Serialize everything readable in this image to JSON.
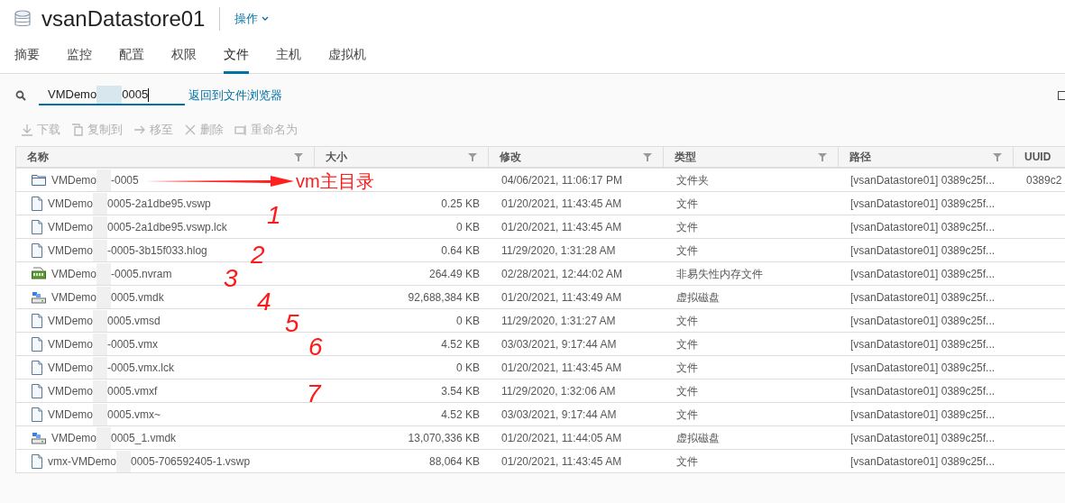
{
  "header": {
    "title": "vsanDatastore01",
    "actions_menu": "操作"
  },
  "tabs": [
    {
      "label": "摘要",
      "selected": false
    },
    {
      "label": "监控",
      "selected": false
    },
    {
      "label": "配置",
      "selected": false
    },
    {
      "label": "权限",
      "selected": false
    },
    {
      "label": "文件",
      "selected": true
    },
    {
      "label": "主机",
      "selected": false
    },
    {
      "label": "虚拟机",
      "selected": false
    }
  ],
  "search": {
    "value_start": "VMDemo",
    "value_end": "0005",
    "back_link": "返回到文件浏览器"
  },
  "toolbar": [
    {
      "kind": "download",
      "label": "下载",
      "disabled": true
    },
    {
      "kind": "copy",
      "label": "复制到",
      "disabled": true
    },
    {
      "kind": "move",
      "label": "移至",
      "disabled": true
    },
    {
      "kind": "delete",
      "label": "删除",
      "disabled": true
    },
    {
      "kind": "rename",
      "label": "重命名为",
      "disabled": true
    }
  ],
  "table": {
    "columns": [
      {
        "label": "名称",
        "filter": true
      },
      {
        "label": "大小",
        "filter": true
      },
      {
        "label": "修改",
        "filter": true
      },
      {
        "label": "类型",
        "filter": true
      },
      {
        "label": "路径",
        "filter": true
      },
      {
        "label": "UUID"
      }
    ],
    "rows": [
      {
        "kind": "folder",
        "name_start": "VMDemo",
        "name_end": "-0005",
        "modified": "04/06/2021, 11:06:17 PM",
        "type": "文件夹",
        "path": "[vsanDatastore01] 0389c25f...",
        "uuid": "0389c2"
      },
      {
        "kind": "file",
        "name_start": "VMDemo",
        "name_end": "0005-2a1dbe95.vswp",
        "size": "0.25 KB",
        "modified": "01/20/2021, 11:43:45 AM",
        "type": "文件",
        "path": "[vsanDatastore01] 0389c25f..."
      },
      {
        "kind": "file",
        "name_start": "VMDemo",
        "name_end": "0005-2a1dbe95.vswp.lck",
        "size": "0 KB",
        "modified": "01/20/2021, 11:43:45 AM",
        "type": "文件",
        "path": "[vsanDatastore01] 0389c25f..."
      },
      {
        "kind": "file",
        "name_start": "VMDemo",
        "name_end": "-0005-3b15f033.hlog",
        "size": "0.64 KB",
        "modified": "11/29/2020, 1:31:28 AM",
        "type": "文件",
        "path": "[vsanDatastore01] 0389c25f..."
      },
      {
        "kind": "nvram",
        "name_start": "VMDemo",
        "name_end": "-0005.nvram",
        "size": "264.49 KB",
        "modified": "02/28/2021, 12:44:02 AM",
        "type": "非易失性内存文件",
        "path": "[vsanDatastore01] 0389c25f..."
      },
      {
        "kind": "disk",
        "name_start": "VMDemo",
        "name_end": "0005.vmdk",
        "size": "92,688,384 KB",
        "modified": "01/20/2021, 11:43:49 AM",
        "type": "虚拟磁盘",
        "path": "[vsanDatastore01] 0389c25f..."
      },
      {
        "kind": "file",
        "name_start": "VMDemo",
        "name_end": "0005.vmsd",
        "size": "0 KB",
        "modified": "11/29/2020, 1:31:27 AM",
        "type": "文件",
        "path": "[vsanDatastore01] 0389c25f..."
      },
      {
        "kind": "file",
        "name_start": "VMDemo",
        "name_end": "-0005.vmx",
        "size": "4.52 KB",
        "modified": "03/03/2021, 9:17:44 AM",
        "type": "文件",
        "path": "[vsanDatastore01] 0389c25f..."
      },
      {
        "kind": "file",
        "name_start": "VMDemo",
        "name_end": "-0005.vmx.lck",
        "size": "0 KB",
        "modified": "01/20/2021, 11:43:45 AM",
        "type": "文件",
        "path": "[vsanDatastore01] 0389c25f..."
      },
      {
        "kind": "file",
        "name_start": "VMDemo",
        "name_end": "0005.vmxf",
        "size": "3.54 KB",
        "modified": "11/29/2020, 1:32:06 AM",
        "type": "文件",
        "path": "[vsanDatastore01] 0389c25f..."
      },
      {
        "kind": "file",
        "name_start": "VMDemo",
        "name_end": "0005.vmx~",
        "size": "4.52 KB",
        "modified": "03/03/2021, 9:17:44 AM",
        "type": "文件",
        "path": "[vsanDatastore01] 0389c25f..."
      },
      {
        "kind": "disk",
        "name_start": "VMDemo",
        "name_end": "0005_1.vmdk",
        "size": "13,070,336 KB",
        "modified": "01/20/2021, 11:44:05 AM",
        "type": "虚拟磁盘",
        "path": "[vsanDatastore01] 0389c25f..."
      },
      {
        "kind": "file",
        "name_start": "vmx-VMDemo",
        "name_end": "0005-706592405-1.vswp",
        "size": "88,064 KB",
        "modified": "01/20/2021, 11:43:45 AM",
        "type": "文件",
        "path": "[vsanDatastore01] 0389c25f..."
      }
    ]
  },
  "annotations": [
    {
      "kind": "arrow_label",
      "text": "vm主目录"
    },
    {
      "kind": "number",
      "text": "1"
    },
    {
      "kind": "number",
      "text": "2"
    },
    {
      "kind": "number",
      "text": "3"
    },
    {
      "kind": "number",
      "text": "4"
    },
    {
      "kind": "number",
      "text": "5"
    },
    {
      "kind": "number",
      "text": "6"
    },
    {
      "kind": "number",
      "text": "7"
    }
  ]
}
